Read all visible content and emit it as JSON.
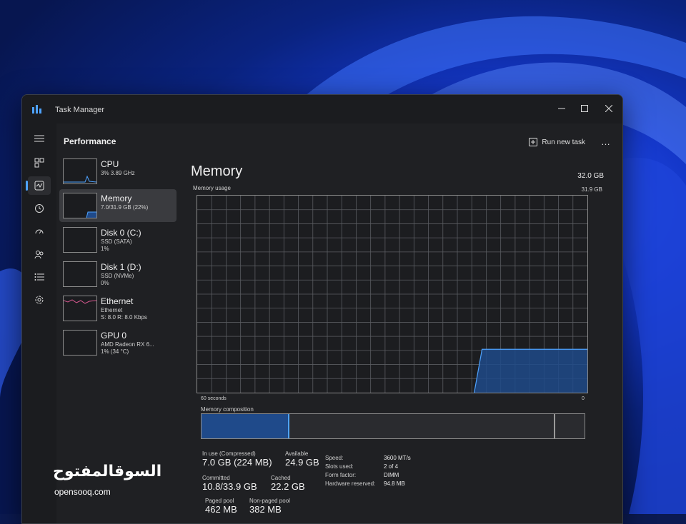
{
  "window": {
    "title": "Task Manager",
    "controls": [
      "minimize",
      "maximize",
      "close"
    ]
  },
  "sidebar": {
    "icons": [
      "hamburger-menu-icon",
      "processes-icon",
      "performance-icon",
      "app-history-icon",
      "startup-apps-icon",
      "users-icon",
      "details-icon",
      "services-icon"
    ],
    "active": "performance-icon"
  },
  "header": {
    "title": "Performance",
    "run_new_task": "Run new task",
    "more": "…"
  },
  "perf_items": [
    {
      "title": "CPU",
      "sub1": "3% 3.89 GHz",
      "sub2": ""
    },
    {
      "title": "Memory",
      "sub1": "7.0/31.9 GB (22%)",
      "sub2": ""
    },
    {
      "title": "Disk 0 (C:)",
      "sub1": "SSD (SATA)",
      "sub2": "1%"
    },
    {
      "title": "Disk 1 (D:)",
      "sub1": "SSD (NVMe)",
      "sub2": "0%"
    },
    {
      "title": "Ethernet",
      "sub1": "Ethernet",
      "sub2": "S: 8.0 R: 8.0 Kbps"
    },
    {
      "title": "GPU 0",
      "sub1": "AMD Radeon RX 6...",
      "sub2": "1% (34 °C)"
    }
  ],
  "selected_item": "Memory",
  "detail": {
    "title": "Memory",
    "total": "32.0 GB",
    "usage_label": "Memory usage",
    "usage_max": "31.9 GB",
    "time_label": "60 seconds",
    "zero_label": "0",
    "composition_label": "Memory composition",
    "composition_in_use_fraction": 0.225,
    "composition_modified_fraction": 0.92,
    "usage_level_fraction": 0.22
  },
  "stats": {
    "in_use_label": "In use (Compressed)",
    "in_use_value": "7.0 GB (224 MB)",
    "available_label": "Available",
    "available_value": "24.9 GB",
    "committed_label": "Committed",
    "committed_value": "10.8/33.9 GB",
    "cached_label": "Cached",
    "cached_value": "22.2 GB",
    "paged_pool_label": "Paged pool",
    "paged_pool_value": "462 MB",
    "nonpaged_pool_label": "Non-paged pool",
    "nonpaged_pool_value": "382 MB"
  },
  "specs": [
    {
      "label": "Speed:",
      "value": "3600 MT/s"
    },
    {
      "label": "Slots used:",
      "value": "2 of 4"
    },
    {
      "label": "Form factor:",
      "value": "DIMM"
    },
    {
      "label": "Hardware reserved:",
      "value": "94.8 MB"
    }
  ],
  "watermark": {
    "arabic": "السوقالمفتوح",
    "english": "opensooq.com"
  },
  "colors": {
    "accent": "#4ea3ff",
    "fill": "#1f4a8a",
    "window_bg": "#202124",
    "ethernet": "#d4578e"
  }
}
